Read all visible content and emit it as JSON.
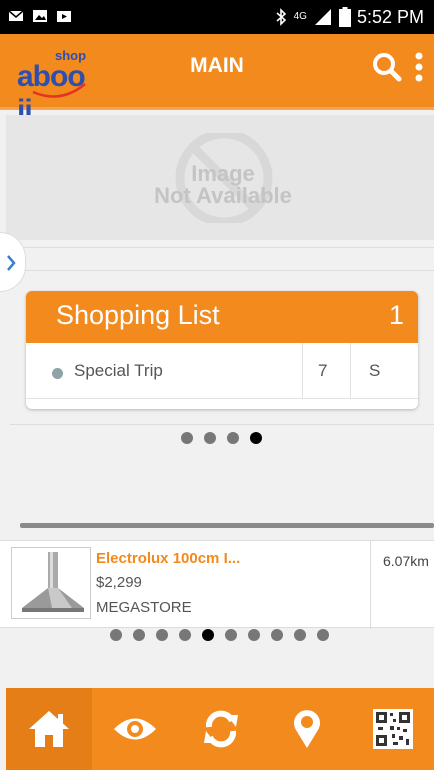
{
  "status_bar": {
    "time": "5:52 PM",
    "network": "4G",
    "icons": [
      "email-icon",
      "image-icon",
      "video-icon",
      "bluetooth-icon",
      "signal-icon",
      "battery-icon"
    ]
  },
  "app_bar": {
    "logo_small": "shop",
    "logo_main": "aboo ji",
    "title": "MAIN",
    "icons": [
      "search-icon",
      "more-vertical-icon"
    ]
  },
  "banner": {
    "placeholder_line1": "Image",
    "placeholder_line2": "Not Available"
  },
  "shopping_list": {
    "title": "Shopping List",
    "count": "1",
    "items": [
      {
        "name": "Special Trip",
        "qty": "7",
        "size": "S"
      }
    ]
  },
  "pager_top": {
    "count": 4,
    "active": 3
  },
  "product": {
    "name": "Electrolux 100cm I...",
    "price": "$2,299",
    "store": "MEGASTORE",
    "distance": "6.07km"
  },
  "pager_bottom": {
    "count": 10,
    "active": 4
  },
  "bottom_nav": [
    "home-icon",
    "eye-icon",
    "refresh-icon",
    "location-pin-icon",
    "qr-code-icon"
  ],
  "colors": {
    "accent": "#f28a1e",
    "logo": "#2d4fb0"
  }
}
